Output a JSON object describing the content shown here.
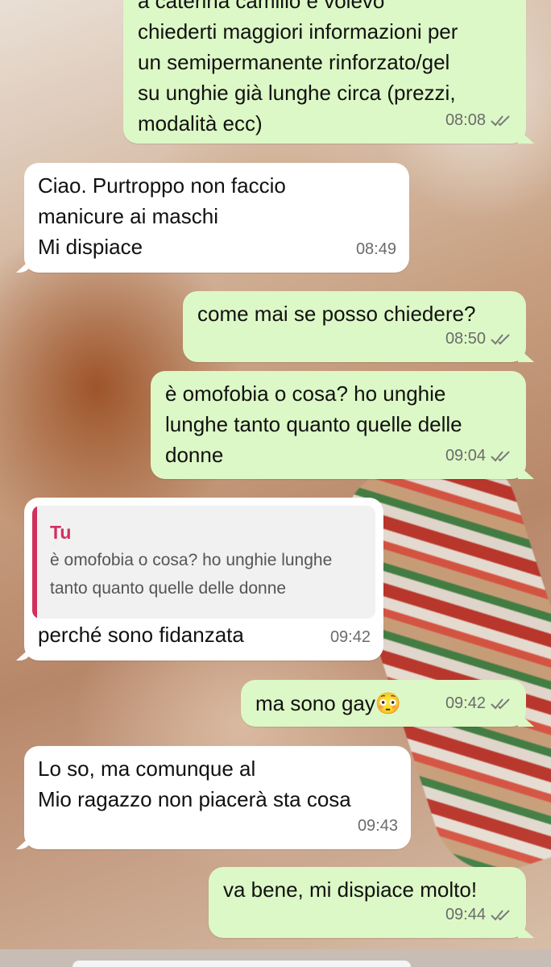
{
  "chat": {
    "messages": [
      {
        "direction": "out",
        "text": "a caterina camillo e volevo\nchiederti maggiori informazioni per\nun semipermanente rinforzato/gel\nsu unghie già lunghe circa (prezzi,\nmodalità ecc)",
        "time": "08:08",
        "status": "read"
      },
      {
        "direction": "in",
        "text": "Ciao. Purtroppo non faccio\nmanicure ai maschi\nMi dispiace",
        "time": "08:49"
      },
      {
        "direction": "out",
        "text": "come mai se posso chiedere?",
        "time": "08:50",
        "status": "read"
      },
      {
        "direction": "out",
        "text": "è omofobia o cosa? ho unghie\nlunghe tanto quanto quelle delle\ndonne",
        "time": "09:04",
        "status": "read"
      },
      {
        "direction": "in",
        "quote_author": "Tu",
        "quote_text": "è omofobia o cosa? ho unghie lunghe\ntanto quanto quelle delle donne",
        "text": "perché sono fidanzata",
        "time": "09:42"
      },
      {
        "direction": "out",
        "text": "ma sono gay😳",
        "time": "09:42",
        "status": "read"
      },
      {
        "direction": "in",
        "text": "Lo so, ma comunque al\nMio ragazzo non piacerà sta cosa",
        "time": "09:43"
      },
      {
        "direction": "out",
        "text": "va bene, mi dispiace molto!",
        "time": "09:44",
        "status": "read"
      }
    ]
  },
  "colors": {
    "incoming_bubble": "#ffffff",
    "outgoing_bubble": "#dcf8c6",
    "quote_accent": "#d1305f",
    "timestamp": "#6b6b6b"
  },
  "icons": {
    "read_receipt": "double-check-icon"
  }
}
